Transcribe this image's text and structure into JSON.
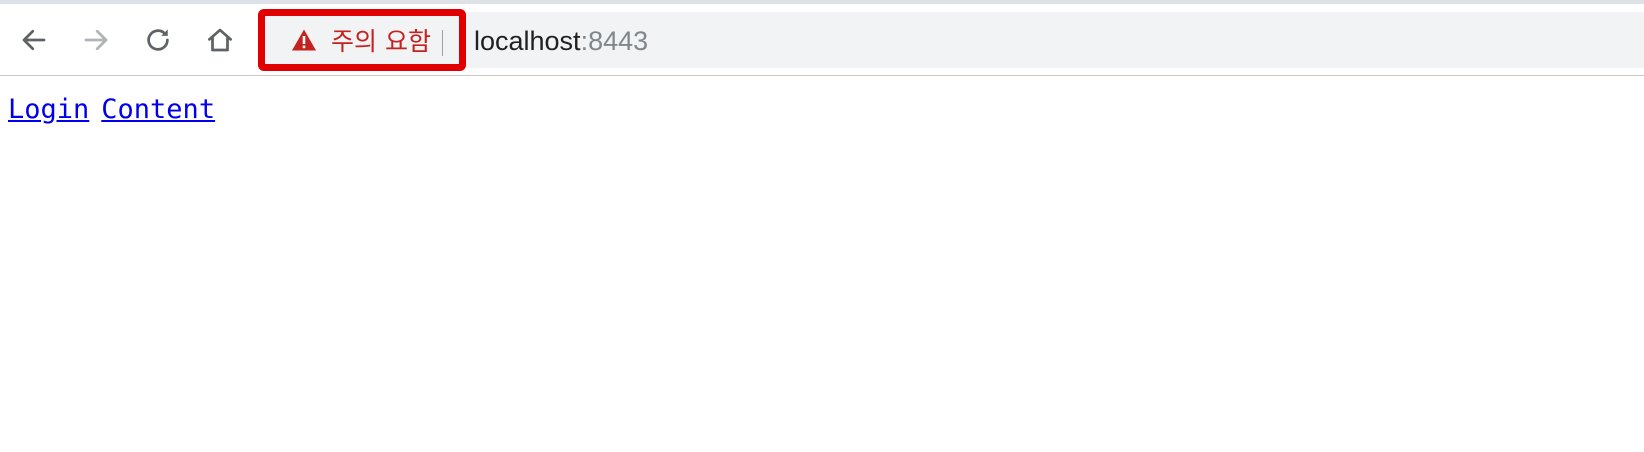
{
  "browser": {
    "toolbar": {
      "back_icon": "arrow-left-icon",
      "forward_icon": "arrow-right-icon",
      "reload_icon": "reload-icon",
      "home_icon": "home-icon"
    },
    "security_chip": {
      "icon": "warning-triangle-icon",
      "label": "주의 요함",
      "color": "#c5221f",
      "highlight_color": "#e00000"
    },
    "address_bar": {
      "host": "localhost",
      "port": ":8443"
    }
  },
  "page": {
    "links": [
      {
        "label": "Login"
      },
      {
        "label": "Content"
      }
    ],
    "link_color": "#0000ee"
  }
}
